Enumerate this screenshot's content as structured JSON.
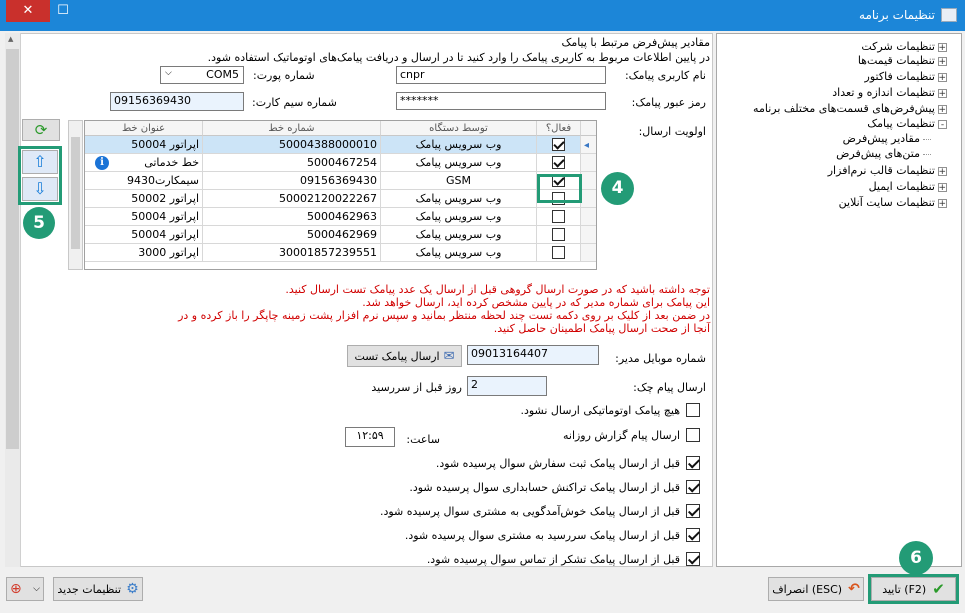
{
  "window": {
    "title": "تنظیمات برنامه"
  },
  "tree": {
    "items": [
      {
        "label": "تنظیمات شرکت",
        "exp": "+"
      },
      {
        "label": "تنظیمات قیمت‌ها",
        "exp": "+"
      },
      {
        "label": "تنظیمات فاکتور",
        "exp": "+"
      },
      {
        "label": "تنظیمات اندازه و تعداد",
        "exp": "+"
      },
      {
        "label": "پیش‌فرض‌های قسمت‌های مختلف برنامه",
        "exp": "+"
      },
      {
        "label": "تنظیمات پیامک",
        "exp": "-"
      },
      {
        "label": "مقادیر پیش‌فرض",
        "exp": ""
      },
      {
        "label": "متن‌های پیش‌فرض",
        "exp": ""
      },
      {
        "label": "تنظیمات قالب نرم‌افزار",
        "exp": "+"
      },
      {
        "label": "تنظیمات ایمیل",
        "exp": "+"
      },
      {
        "label": "تنظیمات سایت آنلاین",
        "exp": "+"
      }
    ]
  },
  "form": {
    "header": "مقادیر پیش‌فرض مرتبط با پیامک",
    "intro": "در پایین اطلاعات مربوط به کاربری پیامک را وارد کنید تا در ارسال و دریافت پیامک‌های اوتوماتیک استفاده شود.",
    "username_label": "نام کاربری پیامک:",
    "username_value": "cnpr",
    "port_label": "شماره پورت:",
    "port_value": "COM5",
    "password_label": "رمز عبور پیامک:",
    "password_value": "*******",
    "sim_label": "شماره سیم کارت:",
    "sim_value": "09156369430",
    "priority_label": "اولویت ارسال:",
    "grid": {
      "headers": [
        "فعال؟",
        "توسط دستگاه",
        "شماره خط",
        "عنوان خط"
      ],
      "rows": [
        {
          "active": true,
          "device": "وب سرویس پیامک",
          "number": "50004388000010",
          "title": "اپراتور 50004"
        },
        {
          "active": true,
          "device": "وب سرویس پیامک",
          "number": "5000467254",
          "title": "خط خدماتی"
        },
        {
          "active": true,
          "device": "GSM",
          "number": "09156369430",
          "title": "سیمکارت9430"
        },
        {
          "active": false,
          "device": "وب سرویس پیامک",
          "number": "50002120022267",
          "title": "اپراتور 50002"
        },
        {
          "active": false,
          "device": "وب سرویس پیامک",
          "number": "5000462963",
          "title": "اپراتور 50004"
        },
        {
          "active": false,
          "device": "وب سرویس پیامک",
          "number": "5000462969",
          "title": "اپراتور 50004"
        },
        {
          "active": false,
          "device": "وب سرویس پیامک",
          "number": "30001857239551",
          "title": "اپراتور 3000"
        }
      ]
    },
    "warning": [
      "توجه داشته باشید که در صورت ارسال گروهی قبل از ارسال یک عدد پیامک تست ارسال کنید.",
      "این پیامک برای شماره مدیر که در پایین مشخص کرده اید، ارسال خواهد شد.",
      "در ضمن بعد از کلیک بر روی دکمه تست چند لحظه منتظر بمانید و سپس نرم افزار پشت زمینه چاپگر را باز کرده و در",
      "آنجا از صحت ارسال پیامک اطمینان حاصل کنید."
    ],
    "manager_label": "شماره موبایل مدیر:",
    "manager_value": "09013164407",
    "test_button": "ارسال پیامک تست",
    "check_label": "ارسال پیام چک:",
    "check_value": "2",
    "check_suffix": "روز قبل از سررسید",
    "options": [
      {
        "label": "هیچ پیامک اوتوماتیکی ارسال نشود.",
        "checked": false
      },
      {
        "label": "ارسال پیام گزارش روزانه",
        "checked": false
      },
      {
        "label": "قبل از ارسال پیامک ثبت سفارش سوال پرسیده شود.",
        "checked": true
      },
      {
        "label": "قبل از ارسال پیامک تراکنش حسابداری سوال پرسیده شود.",
        "checked": true
      },
      {
        "label": "قبل از ارسال پیامک خوش‌آمدگویی به مشتری سوال پرسیده شود.",
        "checked": true
      },
      {
        "label": "قبل از ارسال پیامک سررسید به مشتری سوال پرسیده شود.",
        "checked": true
      },
      {
        "label": "قبل از ارسال پیامک تشکر از تماس سوال پرسیده شود.",
        "checked": true
      }
    ],
    "time_label": "ساعت:",
    "time_value": "۱۲:۵۹"
  },
  "footer": {
    "ok_button": "تایید (F2)",
    "cancel_button": "انصراف (ESC)",
    "new_settings_button": "تنظیمات جدید"
  },
  "callouts": {
    "c4": "4",
    "c5": "5",
    "c6": "6"
  },
  "colors": {
    "titlebar": "#1c86d8",
    "callout": "#239b76",
    "warning": "#d00000"
  }
}
